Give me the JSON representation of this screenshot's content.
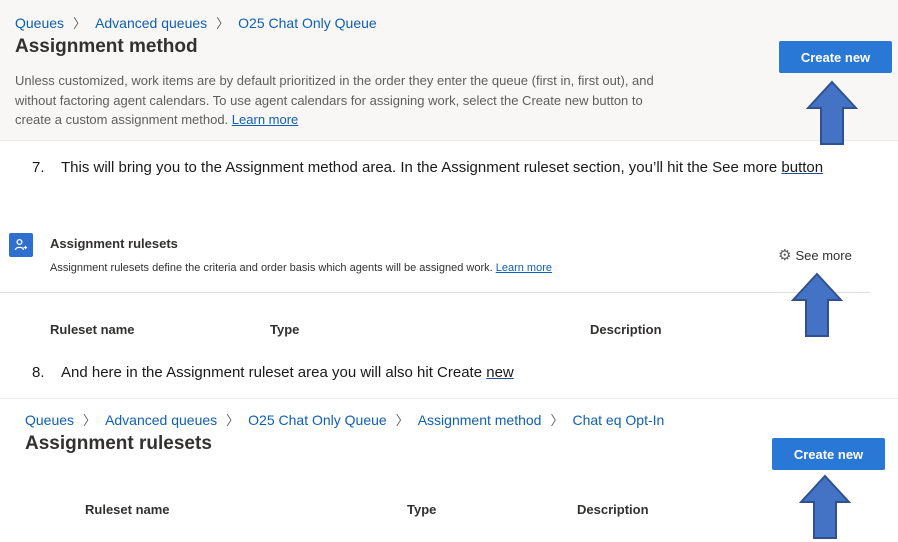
{
  "section1": {
    "breadcrumb": [
      "Queues",
      "Advanced queues",
      "O25 Chat Only Queue"
    ],
    "title": "Assignment method",
    "description": "Unless customized, work items are by default prioritized in the order they enter the queue (first in, first out), and without factoring agent calendars. To use agent calendars for assigning work, select the Create new button to create a custom assignment method.",
    "learn_more": "Learn more",
    "create_button": "Create new"
  },
  "step7": {
    "number": "7.",
    "text": "This will bring you to the Assignment method area. In the Assignment ruleset section, you’ll hit the See more",
    "underlined": "button"
  },
  "section2": {
    "title": "Assignment rulesets",
    "description": "Assignment rulesets define the criteria and order basis which agents will be assigned work.",
    "learn_more": "Learn more",
    "see_more": "See more",
    "columns": [
      "Ruleset name",
      "Type",
      "Description"
    ]
  },
  "step8": {
    "number": "8.",
    "text": "And here in the Assignment ruleset area you will also hit Create",
    "underlined": "new"
  },
  "section3": {
    "breadcrumb": [
      "Queues",
      "Advanced queues",
      "O25 Chat Only Queue",
      "Assignment method",
      "Chat eq Opt-In"
    ],
    "title": "Assignment rulesets",
    "create_button": "Create new",
    "columns": [
      "Ruleset name",
      "Type",
      "Description"
    ]
  },
  "colors": {
    "accent": "#2a78d6",
    "link": "#0f5fb6",
    "arrow_fill": "#4472c4",
    "arrow_stroke": "#2f528f"
  }
}
